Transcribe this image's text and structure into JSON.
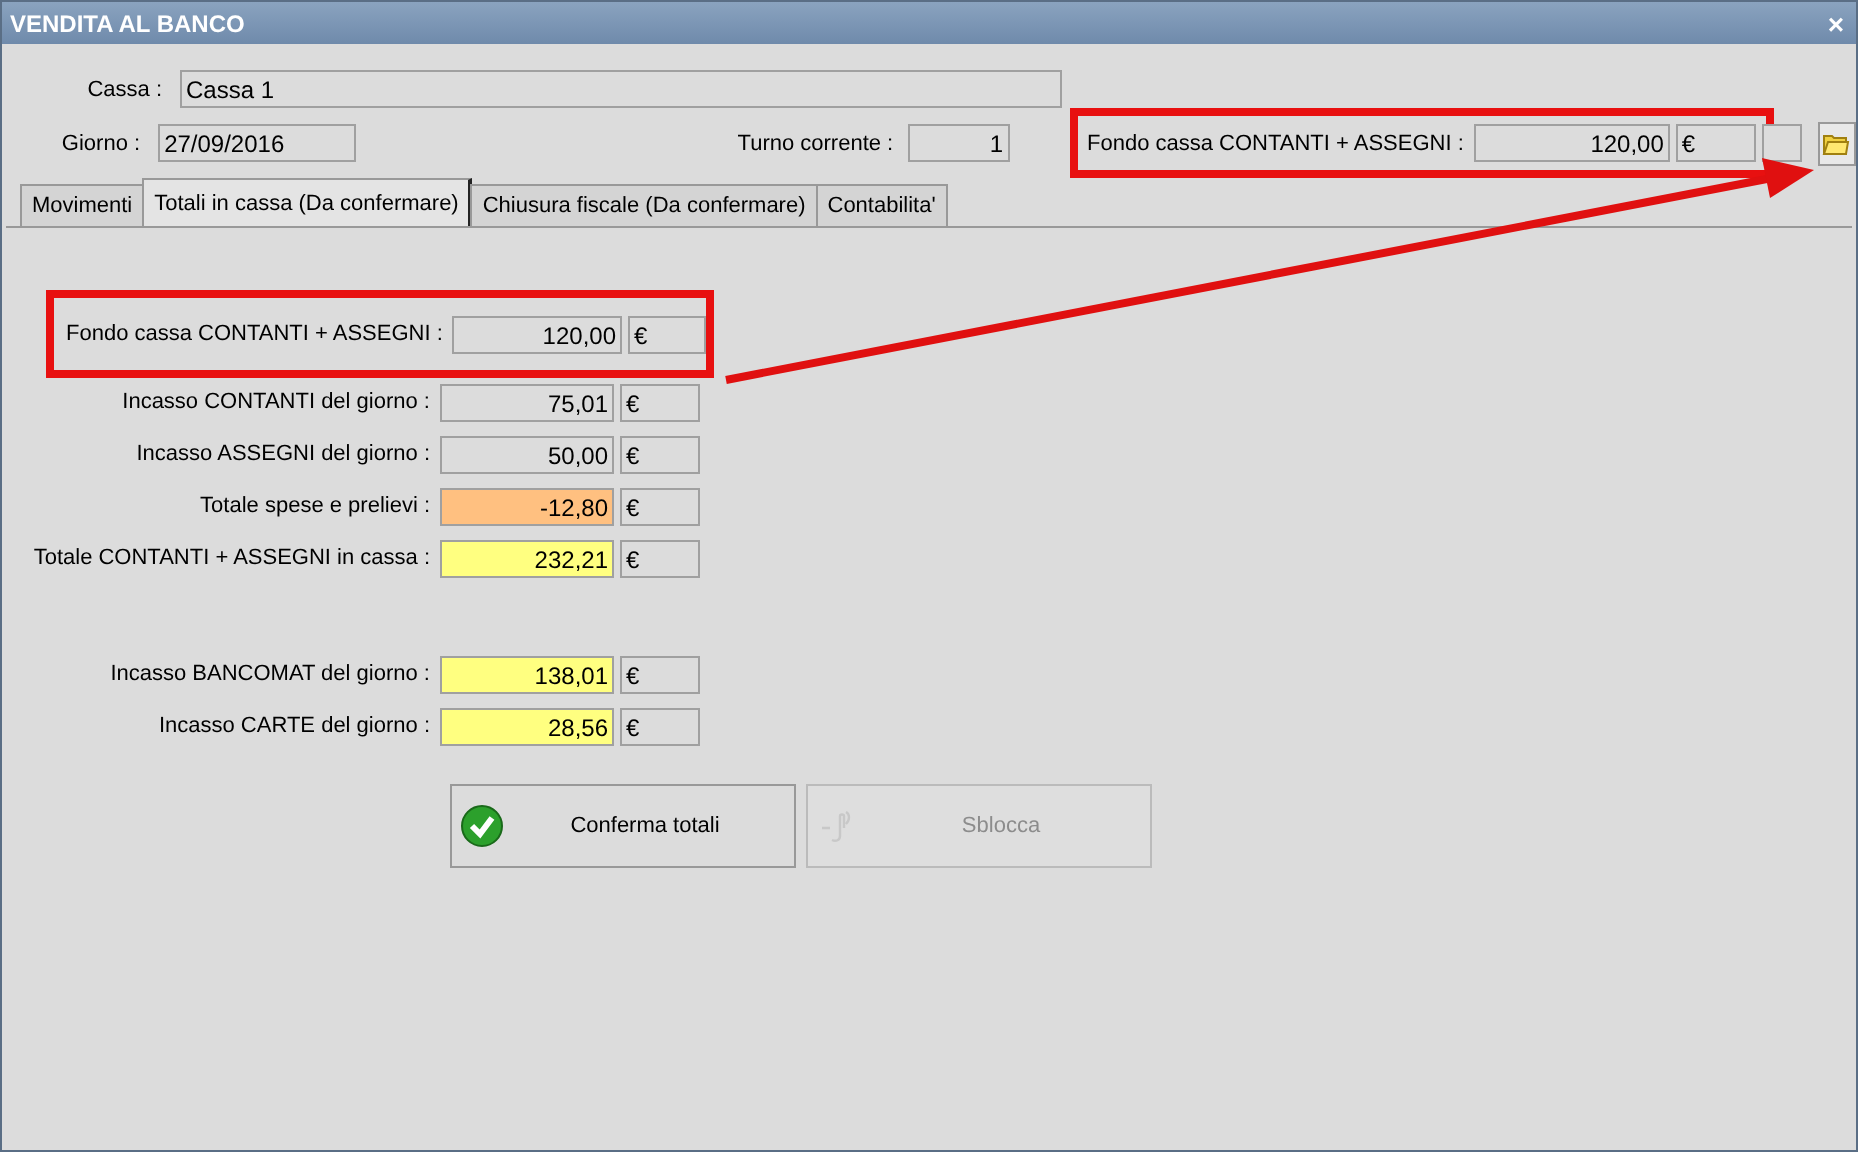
{
  "window": {
    "title": "VENDITA AL BANCO",
    "close": "×"
  },
  "header": {
    "cassa_label": "Cassa :",
    "cassa": "Cassa 1",
    "giorno_label": "Giorno :",
    "giorno": "27/09/2016",
    "turno_label": "Turno corrente :",
    "turno": "1",
    "fondo_label": "Fondo cassa CONTANTI + ASSEGNI :",
    "fondo": "120,00",
    "fondo_currency": "€",
    "fondo_highlighted": true
  },
  "tabs": [
    {
      "label": "Movimenti",
      "selected": false
    },
    {
      "label": "Totali in cassa (Da confermare)",
      "selected": true
    },
    {
      "label": "Chiusura fiscale (Da confermare)",
      "selected": false
    },
    {
      "label": "Contabilita'",
      "selected": false
    }
  ],
  "totals": [
    {
      "label": "Fondo cassa CONTANTI + ASSEGNI :",
      "value": "120,00",
      "currency": "€",
      "color": "#dcdcdc",
      "highlighted": true
    },
    {
      "label": "Incasso CONTANTI del giorno :",
      "value": "75,01",
      "currency": "€",
      "color": "#dcdcdc",
      "highlighted": false
    },
    {
      "label": "Incasso ASSEGNI del giorno :",
      "value": "50,00",
      "currency": "€",
      "color": "#dcdcdc",
      "highlighted": false
    },
    {
      "label": "Totale spese e prelievi :",
      "value": "-12,80",
      "currency": "€",
      "color": "#ffc080",
      "highlighted": false
    },
    {
      "label": "Totale CONTANTI + ASSEGNI in cassa :",
      "value": "232,21",
      "currency": "€",
      "color": "#ffff80",
      "highlighted": false
    }
  ],
  "card_totals": [
    {
      "label": "Incasso BANCOMAT del giorno :",
      "value": "138,01",
      "currency": "€",
      "color": "#ffff80"
    },
    {
      "label": "Incasso CARTE del giorno :",
      "value": "28,56",
      "currency": "€",
      "color": "#ffff80"
    }
  ],
  "buttons": [
    {
      "kind": "confirm",
      "label": "Conferma totali",
      "disabled": false
    },
    {
      "kind": "unlock",
      "label": "Sblocca",
      "disabled": true
    }
  ],
  "annotation_arrow": true
}
